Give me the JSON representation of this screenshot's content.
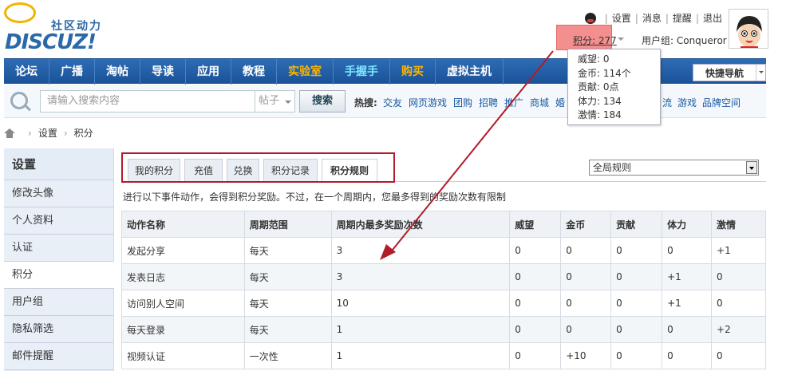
{
  "logo": {
    "slogan": "社区动力",
    "brand": "DISCUZ!"
  },
  "top_links": [
    "设置",
    "消息",
    "提醒",
    "退出"
  ],
  "credit": {
    "label": "积分: 277"
  },
  "user_group": "用户组: Conqueror",
  "credit_popup": [
    "威望: 0",
    "金币: 114个",
    "贡献: 0点",
    "体力: 134",
    "激情: 184"
  ],
  "nav": {
    "items": [
      {
        "label": "论坛",
        "style": "normal"
      },
      {
        "label": "广播",
        "style": "normal"
      },
      {
        "label": "淘帖",
        "style": "normal"
      },
      {
        "label": "导读",
        "style": "normal"
      },
      {
        "label": "应用",
        "style": "normal"
      },
      {
        "label": "教程",
        "style": "normal"
      },
      {
        "label": "实验室",
        "style": "orange"
      },
      {
        "label": "手握手",
        "style": "cyan"
      },
      {
        "label": "购买",
        "style": "orange"
      },
      {
        "label": "虚拟主机",
        "style": "normal"
      }
    ],
    "quick_nav": "快捷导航"
  },
  "search": {
    "placeholder": "请输入搜索内容",
    "type": "帖子",
    "button": "搜索",
    "hot_label": "热搜:",
    "hot_items": [
      "交友",
      "网页游戏",
      "团购",
      "招聘",
      "推广",
      "商城",
      "婚",
      "流",
      "游戏",
      "品牌空间"
    ]
  },
  "breadcrumb": [
    "设置",
    "积分"
  ],
  "sidebar": {
    "title": "设置",
    "items": [
      "修改头像",
      "个人资料",
      "认证",
      "积分",
      "用户组",
      "隐私筛选",
      "邮件提醒"
    ]
  },
  "tabs": [
    "我的积分",
    "充值",
    "兑换",
    "积分记录",
    "积分规则"
  ],
  "rule_select": "全局规则",
  "note": "进行以下事件动作，会得到积分奖励。不过，在一个周期内，您最多得到的奖励次数有限制",
  "table": {
    "headers": [
      "动作名称",
      "周期范围",
      "周期内最多奖励次数",
      "威望",
      "金币",
      "贡献",
      "体力",
      "激情"
    ],
    "rows": [
      [
        "发起分享",
        "每天",
        "3",
        "0",
        "0",
        "0",
        "0",
        "+1"
      ],
      [
        "发表日志",
        "每天",
        "3",
        "0",
        "0",
        "0",
        "+1",
        "0"
      ],
      [
        "访问别人空间",
        "每天",
        "10",
        "0",
        "0",
        "0",
        "+1",
        "0"
      ],
      [
        "每天登录",
        "每天",
        "1",
        "0",
        "0",
        "0",
        "0",
        "+2"
      ],
      [
        "视频认证",
        "一次性",
        "1",
        "0",
        "+10",
        "0",
        "0",
        "0"
      ]
    ]
  },
  "colors": {
    "nav_blue": "#1f5ea8",
    "highlight_red": "#b21c2a",
    "credit_highlight": "#f48f8f"
  }
}
